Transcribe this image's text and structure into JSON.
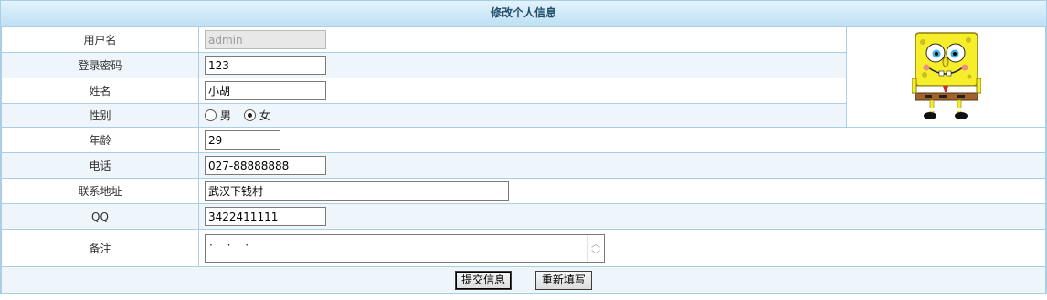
{
  "form": {
    "title": "修改个人信息",
    "fields": {
      "username": {
        "label": "用户名",
        "value": "admin"
      },
      "password": {
        "label": "登录密码",
        "value": "123"
      },
      "name": {
        "label": "姓名",
        "value": "小胡"
      },
      "gender": {
        "label": "性别",
        "options": [
          "男",
          "女"
        ],
        "selected": "女"
      },
      "age": {
        "label": "年龄",
        "value": "29"
      },
      "phone": {
        "label": "电话",
        "value": "027-88888888"
      },
      "address": {
        "label": "联系地址",
        "value": "武汉下钱村"
      },
      "qq": {
        "label": "QQ",
        "value": "3422411111"
      },
      "remark": {
        "label": "备注",
        "value": "· · ·"
      }
    },
    "buttons": {
      "submit": "提交信息",
      "reset": "重新填写"
    },
    "avatar": {
      "icon": "spongebob-avatar"
    }
  }
}
